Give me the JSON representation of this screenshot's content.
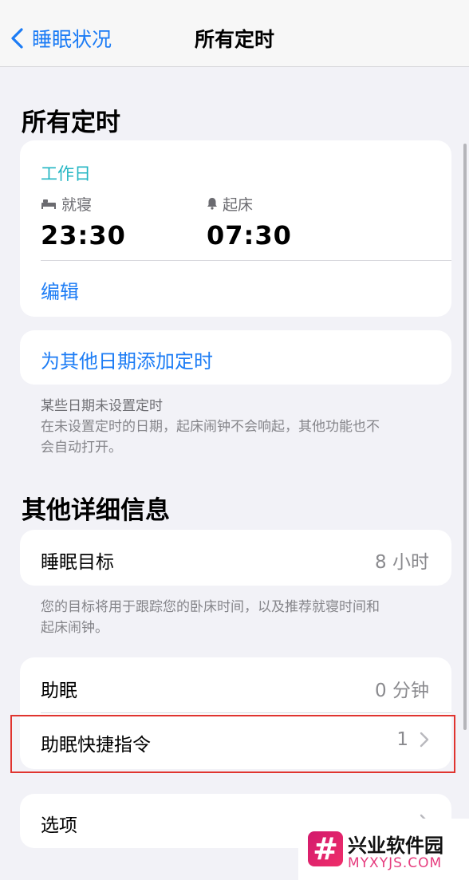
{
  "nav": {
    "back_label": "睡眠状况",
    "title": "所有定时"
  },
  "all_schedules": {
    "header": "所有定时",
    "schedule": {
      "days": "工作日",
      "bedtime_label": "就寝",
      "bedtime": "23:30",
      "wake_label": "起床",
      "wake": "07:30",
      "edit_label": "编辑"
    },
    "add_schedule_label": "为其他日期添加定时",
    "note_title": "某些日期未设置定时",
    "note_body_line1": "在未设置定时的日期，起床闹钟不会响起，其他功能也不",
    "note_body_line2": "会自动打开。"
  },
  "details": {
    "header": "其他详细信息",
    "sleep_goal": {
      "label": "睡眠目标",
      "value": "8 小时"
    },
    "goal_note_line1": "您的目标将用于跟踪您的卧床时间，以及推荐就寝时间和",
    "goal_note_line2": "起床闹钟。",
    "wind_down": {
      "label": "助眠",
      "value": "0 分钟"
    },
    "wind_down_shortcuts": {
      "label": "助眠快捷指令",
      "value": "1"
    },
    "options": {
      "label": "选项"
    }
  },
  "watermark": {
    "name": "兴业软件园",
    "domain": "MYXYJS.COM",
    "logo_glyph": "#"
  },
  "colors": {
    "accent_blue": "#1c7cf5",
    "schedule_teal": "#23b6c3",
    "highlight_red": "#e0342f",
    "background": "#f2f2f7"
  }
}
